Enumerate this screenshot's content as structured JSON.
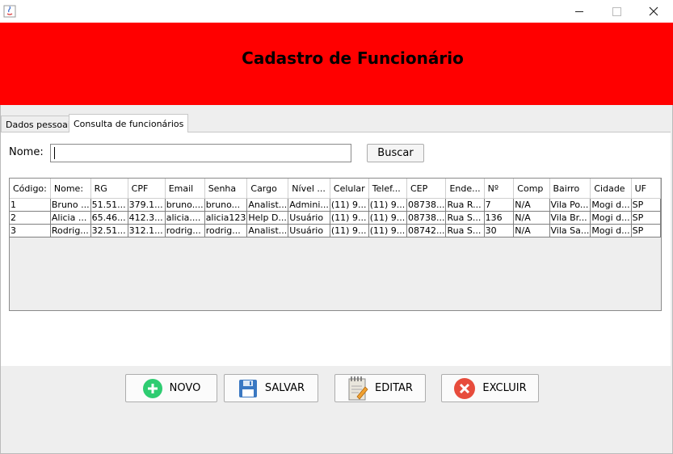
{
  "window": {
    "title": ""
  },
  "header": {
    "title": "Cadastro de Funcionário",
    "bg_color": "#ff0000"
  },
  "tabs": [
    {
      "label": "Dados pessoais",
      "active": false
    },
    {
      "label": "Consulta de funcionários",
      "active": true
    }
  ],
  "search": {
    "label": "Nome:",
    "value": "",
    "button_label": "Buscar"
  },
  "table": {
    "columns": [
      "Código:",
      "Nome:",
      "RG",
      "CPF",
      "Email",
      "Senha",
      "Cargo",
      "Nível ...",
      "Celular",
      "Telef...",
      "CEP",
      "Ende...",
      "Nº",
      "Comp",
      "Bairro",
      "Cidade",
      "UF"
    ],
    "rows": [
      [
        "1",
        "Bruno ...",
        "51.51...",
        "379.1...",
        "bruno....",
        "bruno...",
        "Analist...",
        "Admini...",
        "(11) 9...",
        "(11) 9...",
        "08738...",
        "Rua R...",
        "7",
        "N/A",
        "Vila Po...",
        "Mogi d...",
        "SP"
      ],
      [
        "2",
        "Alicia ...",
        "65.46...",
        "412.3...",
        "alicia....",
        "alicia123",
        "Help D...",
        "Usuário",
        "(11) 9...",
        "(11) 9...",
        "08738...",
        "Rua S...",
        "136",
        "N/A",
        "Vila Br...",
        "Mogi d...",
        "SP"
      ],
      [
        "3",
        "Rodrig...",
        "32.51...",
        "312.1...",
        "rodrig...",
        "rodrig...",
        "Analist...",
        "Usuário",
        "(11) 9...",
        "(11) 9...",
        "08742...",
        "Rua S...",
        "30",
        "N/A",
        "Vila Sa...",
        "Mogi d...",
        "SP"
      ]
    ]
  },
  "buttons": {
    "novo": "NOVO",
    "salvar": "SALVAR",
    "editar": "EDITAR",
    "excluir": "EXCLUIR"
  }
}
